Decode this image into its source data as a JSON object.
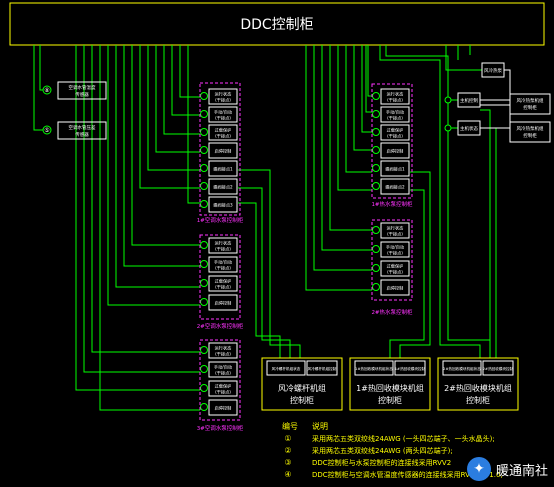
{
  "cabinet": {
    "title": "DDC控制柜"
  },
  "left_blocks": [
    {
      "num": "⑧",
      "lines": [
        "空调水管温度",
        "传感器"
      ]
    },
    {
      "num": "⑤",
      "lines": [
        "空调水管压差",
        "传感器"
      ]
    }
  ],
  "group_1F_ac": {
    "label": "1#空调水泵控制柜",
    "items": [
      {
        "lines": [
          "运行状态",
          "(干接点)"
        ]
      },
      {
        "lines": [
          "手动/自动",
          "(干接点)"
        ]
      },
      {
        "lines": [
          "过载保护",
          "(干接点)"
        ]
      },
      {
        "lines": [
          "启停控制"
        ]
      },
      {
        "lines": [
          "蝶阀接点1"
        ]
      },
      {
        "lines": [
          "蝶阀接点2"
        ]
      },
      {
        "lines": [
          "蝶阀接点3"
        ]
      }
    ]
  },
  "group_2F_ac": {
    "label": "2#空调水泵控制柜",
    "items": [
      {
        "lines": [
          "运行状态",
          "(干接点)"
        ]
      },
      {
        "lines": [
          "手动/自动",
          "(干接点)"
        ]
      },
      {
        "lines": [
          "过载保护",
          "(干接点)"
        ]
      },
      {
        "lines": [
          "启停控制"
        ]
      }
    ]
  },
  "group_3F_ac": {
    "label": "3#空调水泵控制柜",
    "items": [
      {
        "lines": [
          "运行状态",
          "(干接点)"
        ]
      },
      {
        "lines": [
          "手动/自动",
          "(干接点)"
        ]
      },
      {
        "lines": [
          "过载保护",
          "(干接点)"
        ]
      },
      {
        "lines": [
          "启停控制"
        ]
      }
    ]
  },
  "group_1F_hw": {
    "label": "1#热水泵控制柜",
    "items": [
      {
        "lines": [
          "运行状态",
          "(干接点)"
        ]
      },
      {
        "lines": [
          "手动/自动",
          "(干接点)"
        ]
      },
      {
        "lines": [
          "过载保护",
          "(干接点)"
        ]
      },
      {
        "lines": [
          "启停控制"
        ]
      },
      {
        "lines": [
          "蝶阀接点1"
        ]
      },
      {
        "lines": [
          "蝶阀接点2"
        ]
      }
    ]
  },
  "group_2F_hw": {
    "label": "2#热水泵控制柜",
    "items": [
      {
        "lines": [
          "运行状态",
          "(干接点)"
        ]
      },
      {
        "lines": [
          "手动/自动",
          "(干接点)"
        ]
      },
      {
        "lines": [
          "过载保护",
          "(干接点)"
        ]
      },
      {
        "lines": [
          "启停控制"
        ]
      }
    ]
  },
  "right_top": {
    "net_label": "风冷热泵",
    "b1": "主机控制",
    "b2": "主机状态",
    "out": [
      "风冷热泵机组",
      "控制柜"
    ]
  },
  "bottom_panels": [
    {
      "small": [
        "风冷螺杆机组状态",
        "风冷螺杆机组控制"
      ],
      "big": [
        "风冷螺杆机组",
        "控制柜"
      ]
    },
    {
      "small": [
        "1#热回收模块机组状态",
        "1#热回收模块控制"
      ],
      "big": [
        "1#热回收模块机组",
        "控制柜"
      ]
    },
    {
      "small": [
        "2#热回收模块机组状态",
        "2#热回收模块控制"
      ],
      "big": [
        "2#热回收模块机组",
        "控制柜"
      ]
    }
  ],
  "legend": {
    "header_num": "编号",
    "header_desc": "说明",
    "rows": [
      {
        "num": "①",
        "text": "采用两芯五类双绞线24AWG (一头四芯端子、一头水晶头);"
      },
      {
        "num": "②",
        "text": "采用两芯五类双绞线24AWG (两头四芯端子);"
      },
      {
        "num": "③",
        "text": "DDC控制柜与水泵控制柜的连接线采用RVV2"
      },
      {
        "num": "④",
        "text": "DDC控制柜与空调水管温度传感器的连接线采用RVVP2×1.0;"
      }
    ]
  },
  "watermark": {
    "text": "暖通南社"
  },
  "colors": {
    "wire": "#00ff00",
    "panel": "#ffff00",
    "group": "#ff33ff",
    "box": "#ffffff"
  }
}
